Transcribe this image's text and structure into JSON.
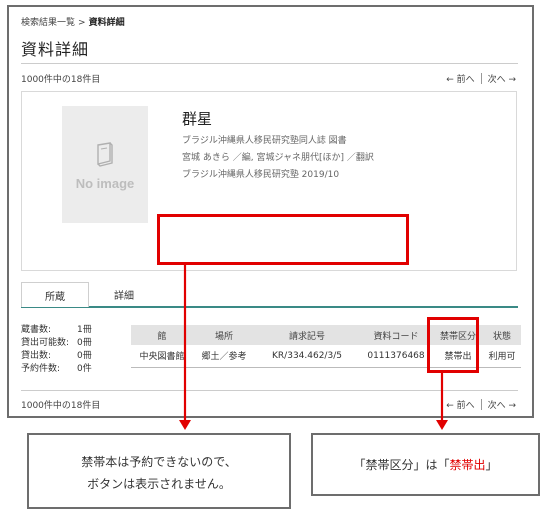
{
  "breadcrumb": {
    "parent": "検索結果一覧",
    "separator": ">",
    "current": "資料詳細"
  },
  "page": {
    "title": "資料詳細"
  },
  "pager_top": {
    "position_text": "1000件中の18件目",
    "prev_label": "← 前へ",
    "next_label": "次へ →"
  },
  "pager_bottom": {
    "position_text": "1000件中の18件目",
    "prev_label": "← 前へ",
    "next_label": "次へ →"
  },
  "record": {
    "noimage_label": "No image",
    "title": "群星",
    "line1": "ブラジル沖縄県人移民研究塾同人誌 図書",
    "line2": "宮城 あきら ／編, 宮城ジャネ朋代[ほか] ／翻訳",
    "line3": "ブラジル沖縄県人移民研究塾 2019/10"
  },
  "tabs": [
    {
      "label": "所蔵"
    },
    {
      "label": "詳細"
    }
  ],
  "stats": [
    {
      "label": "蔵書数:",
      "value": "1冊"
    },
    {
      "label": "貸出可能数:",
      "value": "0冊"
    },
    {
      "label": "貸出数:",
      "value": "0冊"
    },
    {
      "label": "予約件数:",
      "value": "0件"
    }
  ],
  "holdings": {
    "columns": [
      "館",
      "場所",
      "請求記号",
      "資料コード",
      "禁帯区分",
      "状態"
    ],
    "rows": [
      [
        "中央図書館",
        "郷土／参考",
        "KR/334.462/3/5",
        "0111376468",
        "禁帯出",
        "利用可"
      ]
    ]
  },
  "annotations": {
    "note1_line1": "禁帯本は予約できないので、",
    "note1_line2": "ボタンは表示されません。",
    "note2_part1": "「禁帯区分」は「",
    "note2_part2": "禁帯出",
    "note2_part3": "」"
  },
  "colors": {
    "accent": "#e10000",
    "tab_rule": "#3a8a86"
  }
}
